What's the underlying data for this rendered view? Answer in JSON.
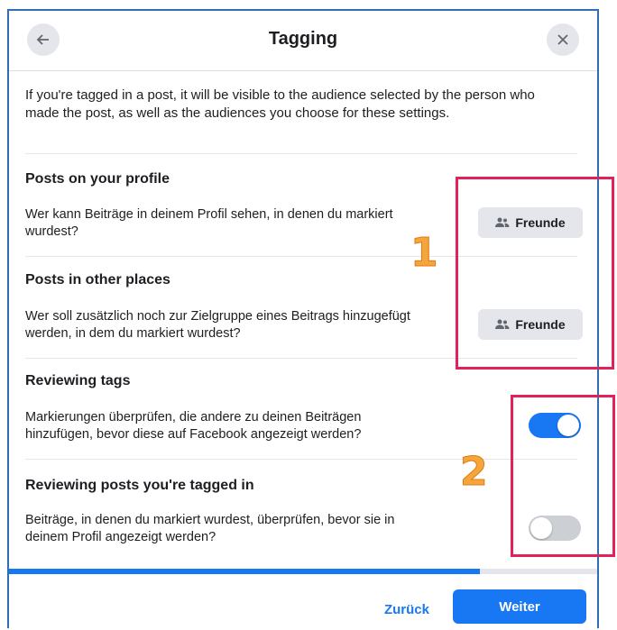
{
  "dialog": {
    "title": "Tagging",
    "back_icon": "arrow-left-icon",
    "close_icon": "close-icon",
    "intro": "If you're tagged in a post, it will be visible to the audience selected by the person who made the post, as well as the audiences you choose for these settings."
  },
  "sections": [
    {
      "title": "Posts on your profile",
      "desc": "Wer kann Beiträge in deinem Profil sehen, in denen du markiert wurdest?",
      "control": "Freunde"
    },
    {
      "title": "Posts in other places",
      "desc": "Wer soll zusätzlich noch zur Zielgruppe eines Beitrags hinzugefügt werden, in dem du markiert wurdest?",
      "control": "Freunde"
    },
    {
      "title": "Reviewing tags",
      "desc": "Markierungen überprüfen, die andere zu deinen Beiträgen hinzufügen, bevor diese auf Facebook angezeigt werden?",
      "toggle": true
    },
    {
      "title": "Reviewing posts you're tagged in",
      "desc": "Beiträge, in denen du markiert wurdest, überprüfen, bevor sie in deinem Profil angezeigt werden?",
      "toggle": false
    }
  ],
  "footer": {
    "back_label": "Zurück",
    "next_label": "Weiter",
    "progress": 0.8
  },
  "annotations": {
    "one": "1",
    "two": "2"
  },
  "colors": {
    "accent": "#1877f2",
    "highlight": "#e0215a",
    "annotation": "#f4a53c"
  }
}
